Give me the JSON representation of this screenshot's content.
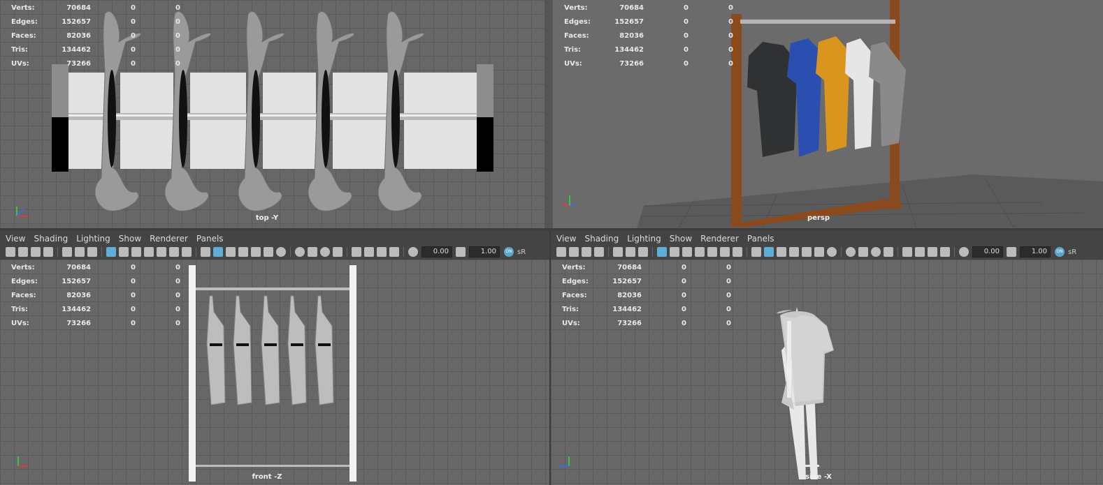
{
  "hud": {
    "rows": [
      {
        "label": "Verts:",
        "v1": "70684",
        "v2": "0",
        "v3": "0"
      },
      {
        "label": "Edges:",
        "v1": "152657",
        "v2": "0",
        "v3": "0"
      },
      {
        "label": "Faces:",
        "v1": "82036",
        "v2": "0",
        "v3": "0"
      },
      {
        "label": "Tris:",
        "v1": "134462",
        "v2": "0",
        "v3": "0"
      },
      {
        "label": "UVs:",
        "v1": "73266",
        "v2": "0",
        "v3": "0"
      }
    ]
  },
  "viewports": {
    "top": {
      "camera": "top -Y"
    },
    "persp": {
      "camera": "persp"
    },
    "front": {
      "camera": "front -Z"
    },
    "side": {
      "camera": "side -X"
    }
  },
  "menu": {
    "view": "View",
    "shading": "Shading",
    "lighting": "Lighting",
    "show": "Show",
    "renderer": "Renderer",
    "panels": "Panels"
  },
  "toolbar": {
    "exposure": "0.00",
    "gamma": "1.00",
    "on_label": "ON",
    "colorspace": "sR"
  },
  "colors": {
    "accent": "#5eaed8",
    "viewport_bg": "#676767",
    "panel_bg": "#444444",
    "wood": "#8a4a1e"
  },
  "shirts": {
    "colors": [
      "#2f3132",
      "#2b4fb0",
      "#d9951e",
      "#e6e6e6",
      "#8a8a8a"
    ]
  }
}
